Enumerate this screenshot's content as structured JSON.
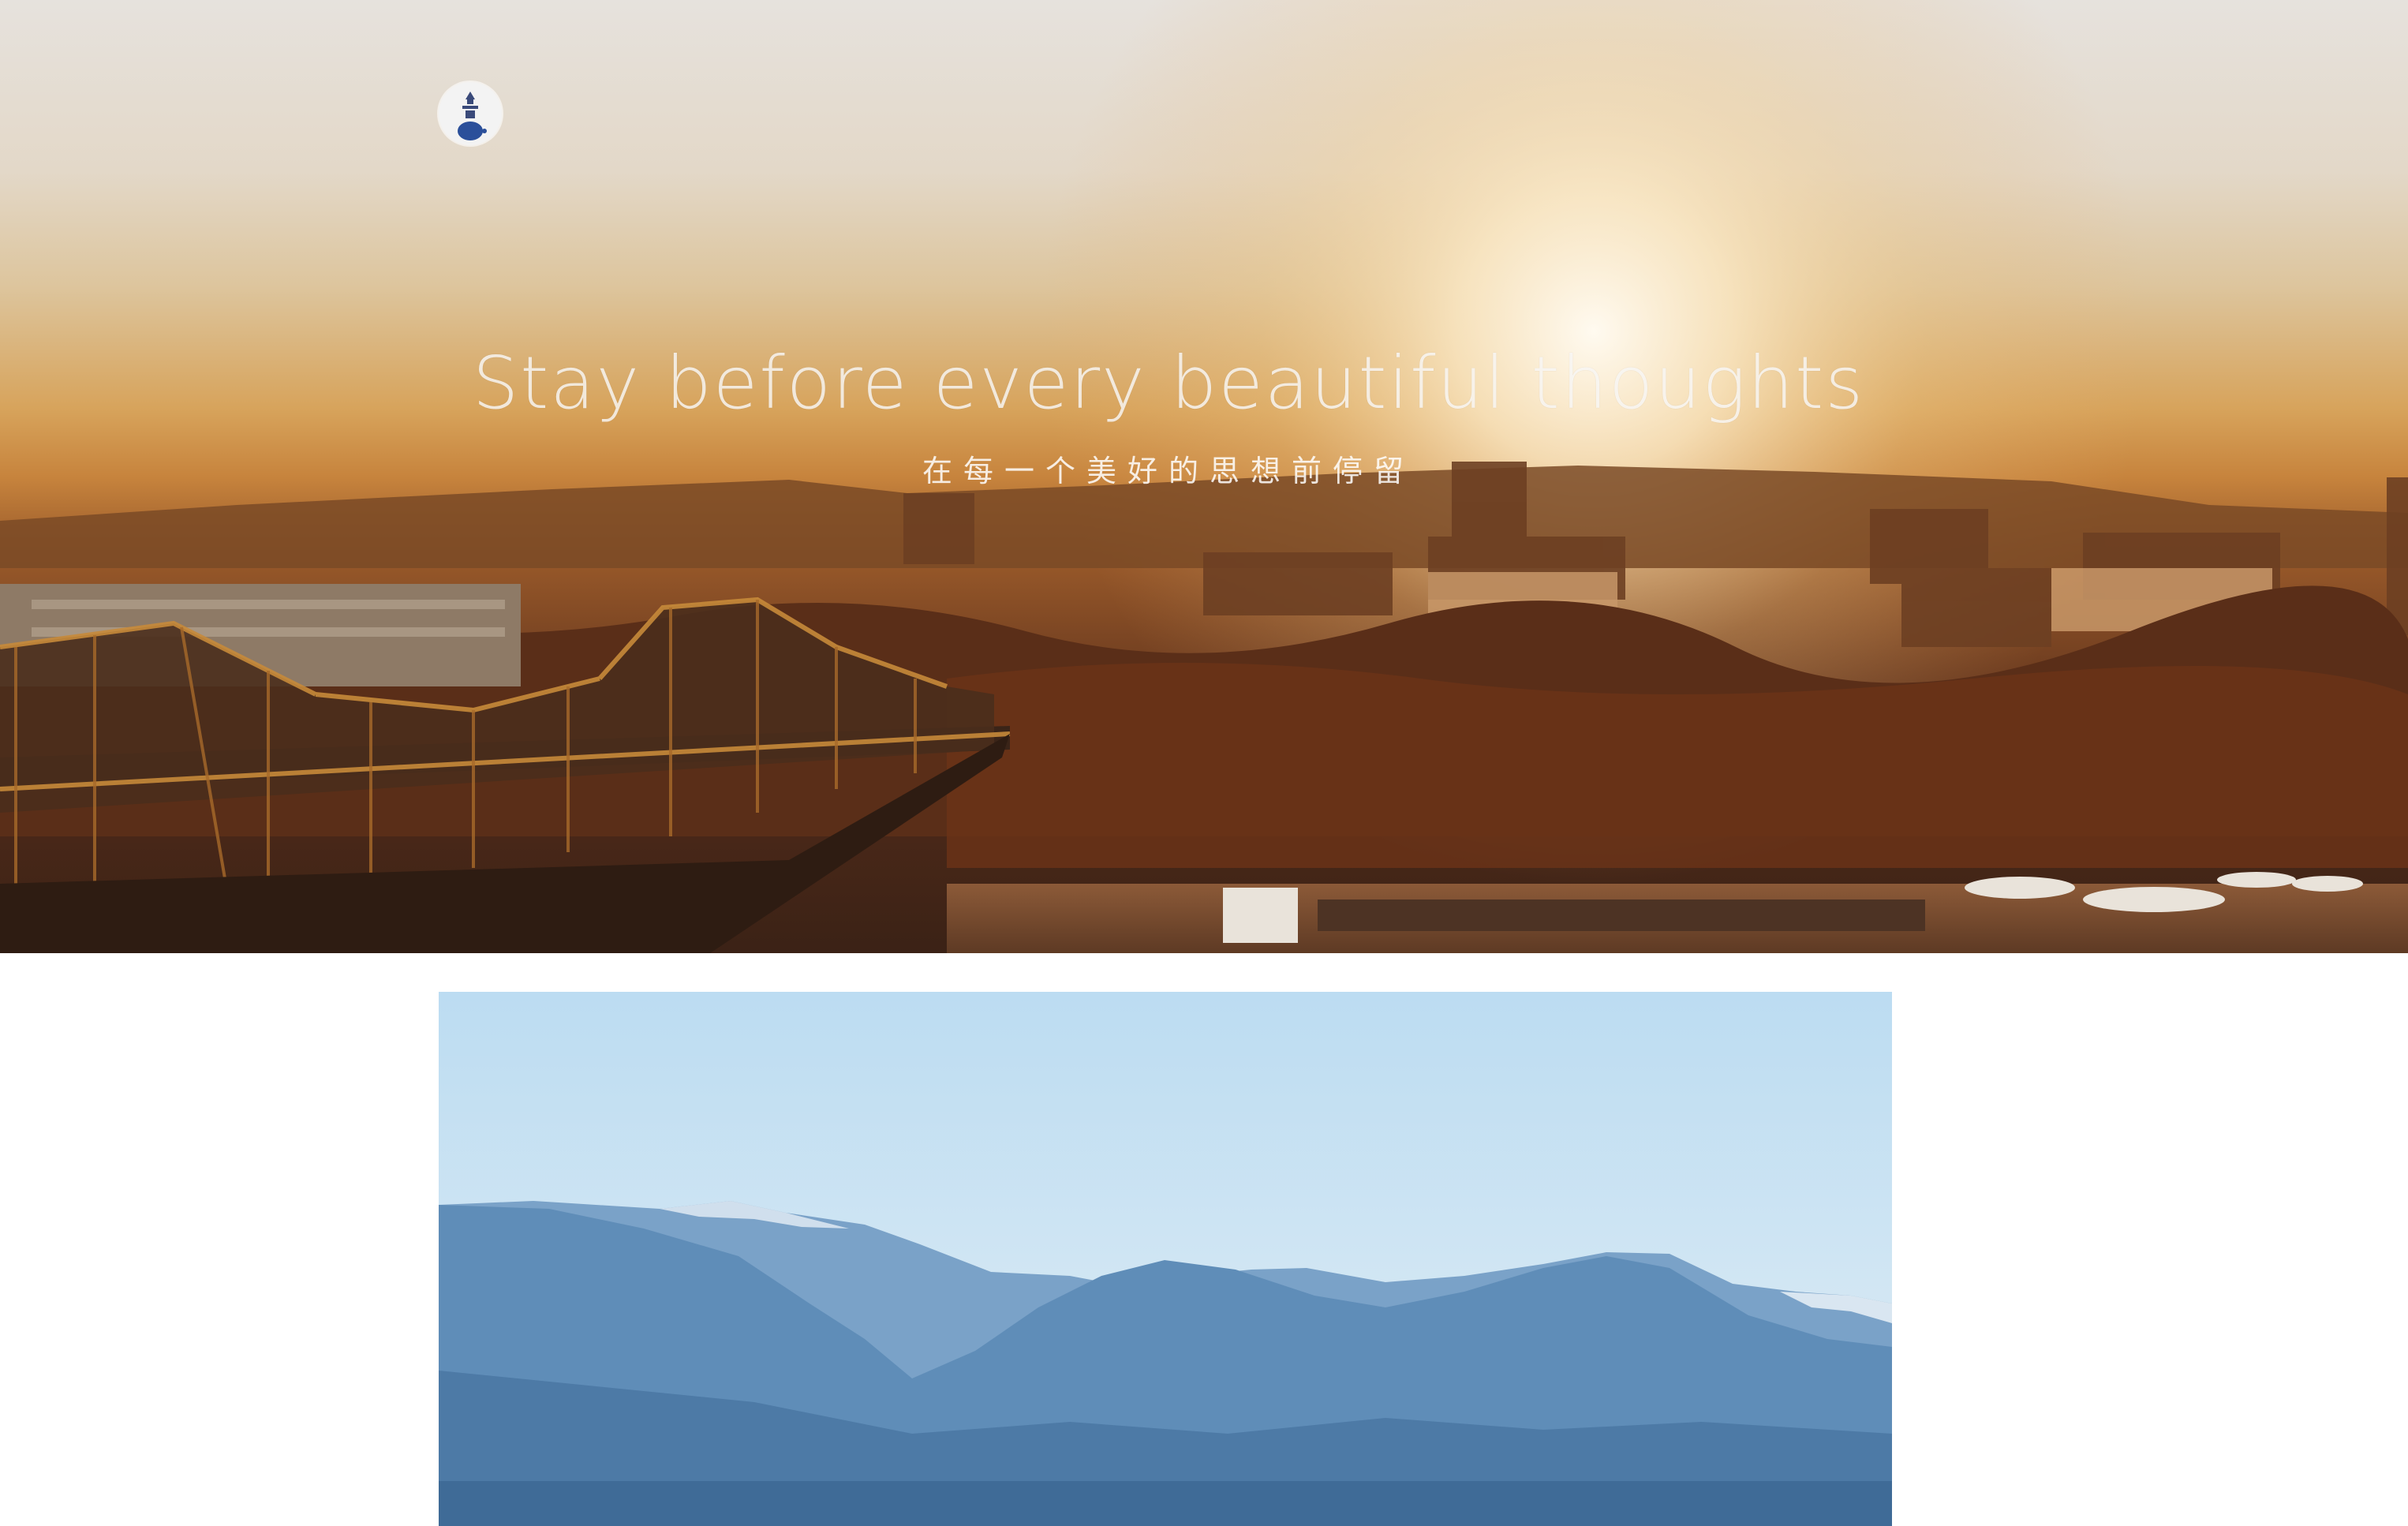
{
  "hero": {
    "logo_icon": "lighthouse-logo-icon",
    "title": "Stay before every beautiful thoughts",
    "subtitle": "在每一个美好的思想前停留",
    "scene": "city-sunset-bridge"
  },
  "card": {
    "scene": "blue-mountains"
  },
  "colors": {
    "sky_top": "#e6e2dd",
    "sun_glow": "#fff4df",
    "city_dark": "#3b2216",
    "mountain_blue": "#5f8db8",
    "sky_blue": "#bcdcf2"
  }
}
